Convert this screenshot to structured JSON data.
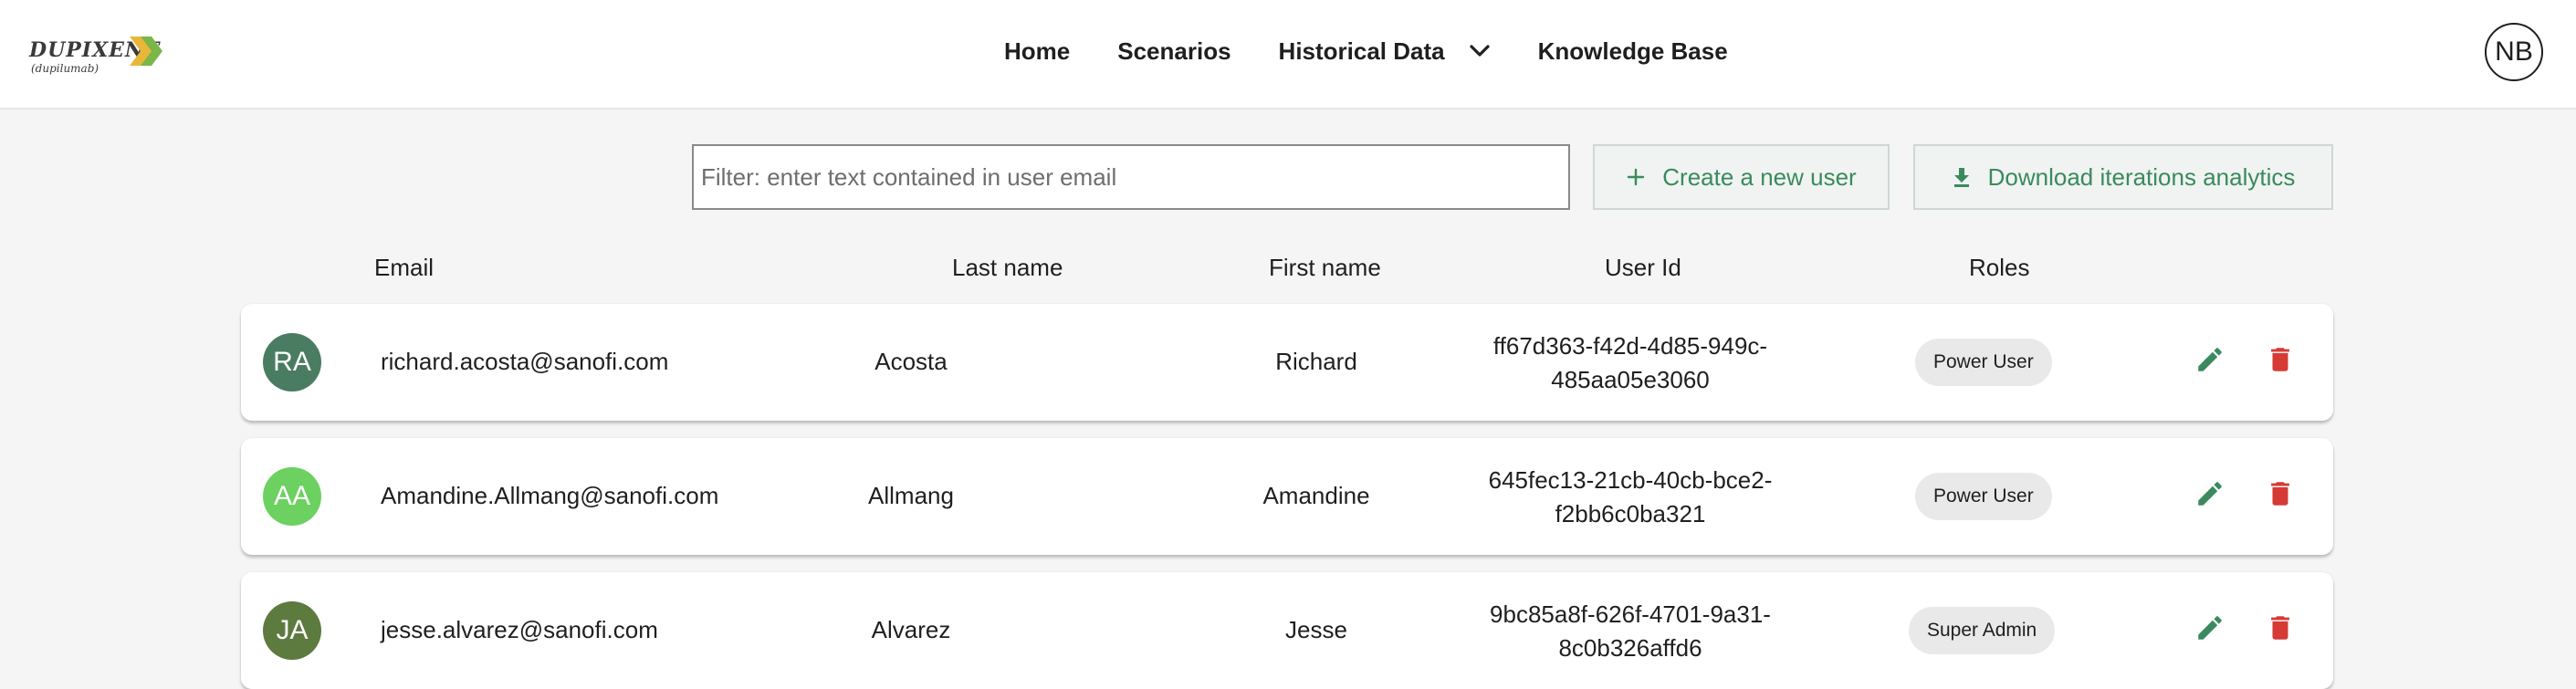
{
  "header": {
    "logo": {
      "wordmark": "DUPIXENT",
      "subtitle": "(dupilumab)",
      "accent_colors": [
        "#e8b73a",
        "#7ab648"
      ]
    },
    "nav": [
      {
        "label": "Home"
      },
      {
        "label": "Scenarios"
      },
      {
        "label": "Historical Data",
        "has_dropdown": true,
        "icon": "chevron-down-icon"
      },
      {
        "label": "Knowledge Base"
      }
    ],
    "user_initials": "NB"
  },
  "toolbar": {
    "filter_placeholder": "Filter: enter text contained in user email",
    "filter_value": "",
    "create_label": "Create a new user",
    "create_icon": "plus-icon",
    "download_label": "Download iterations analytics",
    "download_icon": "download-icon",
    "accent_color": "#3a8a5e"
  },
  "table": {
    "columns": [
      "Email",
      "Last name",
      "First name",
      "User Id",
      "Roles"
    ],
    "rows": [
      {
        "initials": "RA",
        "avatar_color": "#4a7c62",
        "email": "richard.acosta@sanofi.com",
        "last_name": "Acosta",
        "first_name": "Richard",
        "user_id_line1": "ff67d363-f42d-4d85-949c-",
        "user_id_line2": "485aa05e3060",
        "role": "Power User"
      },
      {
        "initials": "AA",
        "avatar_color": "#6cd160",
        "email": "Amandine.Allmang@sanofi.com",
        "last_name": "Allmang",
        "first_name": "Amandine",
        "user_id_line1": "645fec13-21cb-40cb-bce2-",
        "user_id_line2": "f2bb6c0ba321",
        "role": "Power User"
      },
      {
        "initials": "JA",
        "avatar_color": "#5d7a3f",
        "email": "jesse.alvarez@sanofi.com",
        "last_name": "Alvarez",
        "first_name": "Jesse",
        "user_id_line1": "9bc85a8f-626f-4701-9a31-",
        "user_id_line2": "8c0b326affd6",
        "role": "Super Admin"
      }
    ],
    "edit_icon": "pencil-icon",
    "delete_icon": "trash-icon",
    "edit_color": "#3a8a5e",
    "delete_color": "#d63a35"
  }
}
